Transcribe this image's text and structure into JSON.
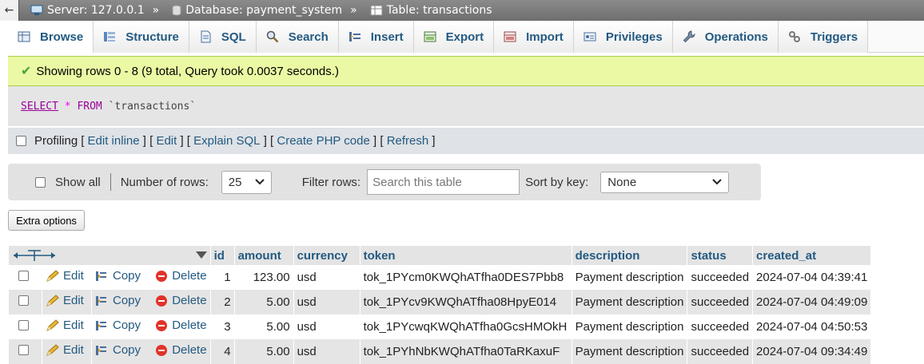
{
  "breadcrumb": {
    "back": "←",
    "server": "Server: 127.0.0.1",
    "database": "Database: payment_system",
    "table": "Table: transactions",
    "separator": "»"
  },
  "tabs": [
    {
      "label": "Browse",
      "icon": "browse-icon"
    },
    {
      "label": "Structure",
      "icon": "structure-icon"
    },
    {
      "label": "SQL",
      "icon": "sql-icon"
    },
    {
      "label": "Search",
      "icon": "search-icon"
    },
    {
      "label": "Insert",
      "icon": "insert-icon"
    },
    {
      "label": "Export",
      "icon": "export-icon"
    },
    {
      "label": "Import",
      "icon": "import-icon"
    },
    {
      "label": "Privileges",
      "icon": "privileges-icon"
    },
    {
      "label": "Operations",
      "icon": "operations-icon"
    },
    {
      "label": "Triggers",
      "icon": "triggers-icon"
    }
  ],
  "success_message": "Showing rows 0 - 8 (9 total, Query took 0.0037 seconds.)",
  "sql": {
    "select": "SELECT",
    "star": "*",
    "from": "FROM",
    "table": "`transactions`"
  },
  "profiling": {
    "label": "Profiling",
    "links": [
      "Edit inline",
      "Edit",
      "Explain SQL",
      "Create PHP code",
      "Refresh"
    ]
  },
  "nav": {
    "show_all": "Show all",
    "number_of_rows_label": "Number of rows:",
    "number_of_rows_value": "25",
    "filter_label": "Filter rows:",
    "filter_placeholder": "Search this table",
    "sort_label": "Sort by key:",
    "sort_value": "None"
  },
  "extra_options": "Extra options",
  "columns": [
    "id",
    "amount",
    "currency",
    "token",
    "description",
    "status",
    "created_at"
  ],
  "row_actions": {
    "edit": "Edit",
    "copy": "Copy",
    "delete": "Delete"
  },
  "rows": [
    {
      "id": "1",
      "amount": "123.00",
      "currency": "usd",
      "token": "tok_1PYcm0KWQhATfha0DES7Pbb8",
      "description": "Payment description",
      "status": "succeeded",
      "created_at": "2024-07-04 04:39:41"
    },
    {
      "id": "2",
      "amount": "5.00",
      "currency": "usd",
      "token": "tok_1PYcv9KWQhATfha08HpyE014",
      "description": "Payment description",
      "status": "succeeded",
      "created_at": "2024-07-04 04:49:09"
    },
    {
      "id": "3",
      "amount": "5.00",
      "currency": "usd",
      "token": "tok_1PYcwqKWQhATfha0GcsHMOkH",
      "description": "Payment description",
      "status": "succeeded",
      "created_at": "2024-07-04 04:50:53"
    },
    {
      "id": "4",
      "amount": "5.00",
      "currency": "usd",
      "token": "tok_1PYhNbKWQhATfha0TaRKaxuF",
      "description": "Payment description",
      "status": "succeeded",
      "created_at": "2024-07-04 09:34:49"
    }
  ],
  "colors": {
    "link": "#235a81",
    "success_bg": "#ebf8a4",
    "delete_red": "#e0332a"
  }
}
